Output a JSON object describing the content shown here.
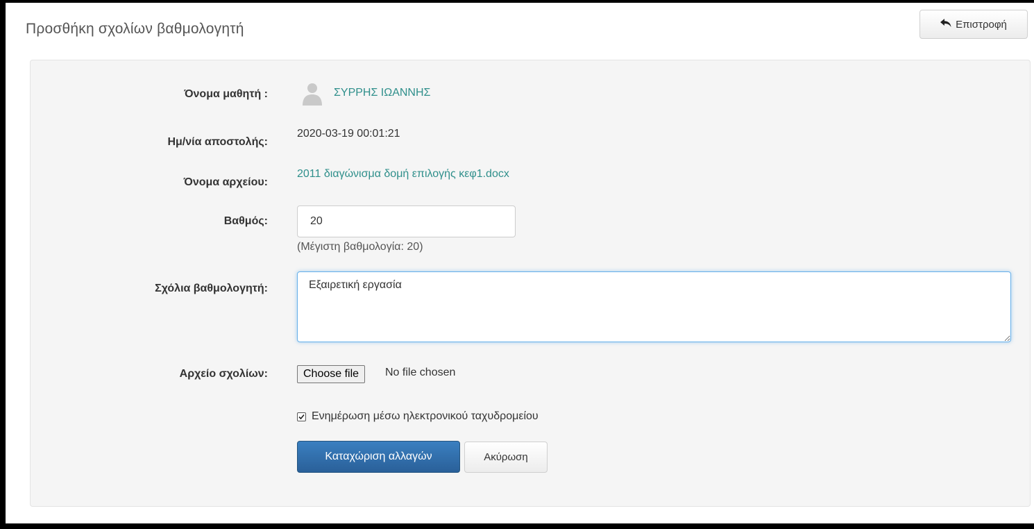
{
  "header": {
    "title": "Προσθήκη σχολίων βαθμολογητή",
    "back_label": "Επιστροφή"
  },
  "form": {
    "student_label": "Όνομα μαθητή :",
    "student_name": "ΣΥΡΡΗΣ ΙΩΑΝΝΗΣ",
    "date_label": "Ημ/νία αποστολής:",
    "date_value": "2020-03-19 00:01:21",
    "file_label": "Όνομα αρχείου:",
    "file_name": "2011 διαγώνισμα δομή επιλογής κεφ1.docx",
    "grade_label": "Βαθμός:",
    "grade_value": "20",
    "max_grade_note": "(Μέγιστη βαθμολογία: 20)",
    "comments_label": "Σχόλια βαθμολογητή:",
    "comments_value": "Εξαιρετική εργασία",
    "comments_file_label": "Αρχείο σχολίων:",
    "choose_file_label": "Choose file",
    "no_file_text": "No file chosen",
    "email_notify_label": "Ενημέρωση μέσω ηλεκτρονικού ταχυδρομείου",
    "email_notify_checked": true,
    "submit_label": "Καταχώριση αλλαγών",
    "cancel_label": "Ακύρωση"
  },
  "icons": {
    "back": "reply-arrow-icon",
    "avatar": "user-avatar-icon",
    "checkbox": "checkmark-icon"
  },
  "colors": {
    "link": "#2f8f8b",
    "primary_button": "#2a6099",
    "focus_border": "#66afe9",
    "panel_bg": "#f5f5f5"
  }
}
